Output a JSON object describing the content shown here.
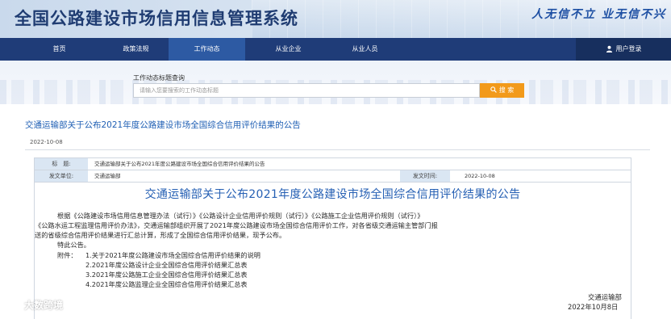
{
  "header": {
    "site_title": "全国公路建设市场信用信息管理系统",
    "slogan": "人无信不立 业无信不兴"
  },
  "nav": {
    "items": [
      "首页",
      "政策法规",
      "工作动态",
      "从业企业",
      "从业人员"
    ],
    "active": "工作动态",
    "login_label": "用户登录"
  },
  "search": {
    "label": "工作动态标题查询",
    "placeholder": "请输入您要搜索的工作动态标题",
    "button_label": "搜 索"
  },
  "article": {
    "title": "交通运输部关于公布2021年度公路建设市场全国综合信用评价结果的公告",
    "date": "2022-10-08"
  },
  "document": {
    "meta": {
      "title_key": "标　题:",
      "title_value": "交通运输部关于公布2021年度公路建设市场全国综合信用评价结果的公告",
      "issuer_key": "发文单位:",
      "issuer_value": "交通运输部",
      "time_key": "发文时间:",
      "time_value": "2022-10-08"
    },
    "heading": "交通运输部关于公布2021年度公路建设市场全国综合信用评价结果的公告",
    "body_lines": [
      "根据《公路建设市场信用信息管理办法（试行）》《公路设计企业信用评价规则（试行）》《公路施工企业信用评价规则（试行）》",
      "《公路水运工程监理信用评价办法》，交通运输部组织开展了2021年度公路建设市场全国综合信用评价工作，对各省级交通运输主管部门报",
      "送的省级综合信用评价结果进行汇总计算，形成了全国综合信用评价结果，现予公布。",
      "特此公告。"
    ],
    "attachments_label": "附件：",
    "attachments": [
      "1.关于2021年度公路建设市场全国综合信用评价结果的说明",
      "2.2021年度公路设计企业全国综合信用评价结果汇总表",
      "3.2021年度公路施工企业全国综合信用评价结果汇总表",
      "4.2021年度公路监理企业全国综合信用评价结果汇总表"
    ],
    "signature": "交通运输部",
    "signature_date": "2022年10月8日"
  },
  "watermark": {
    "text": "大数跨境"
  },
  "colors": {
    "nav": "#1f3c78",
    "accent": "#f29a1a",
    "link": "#1f5fb4"
  }
}
